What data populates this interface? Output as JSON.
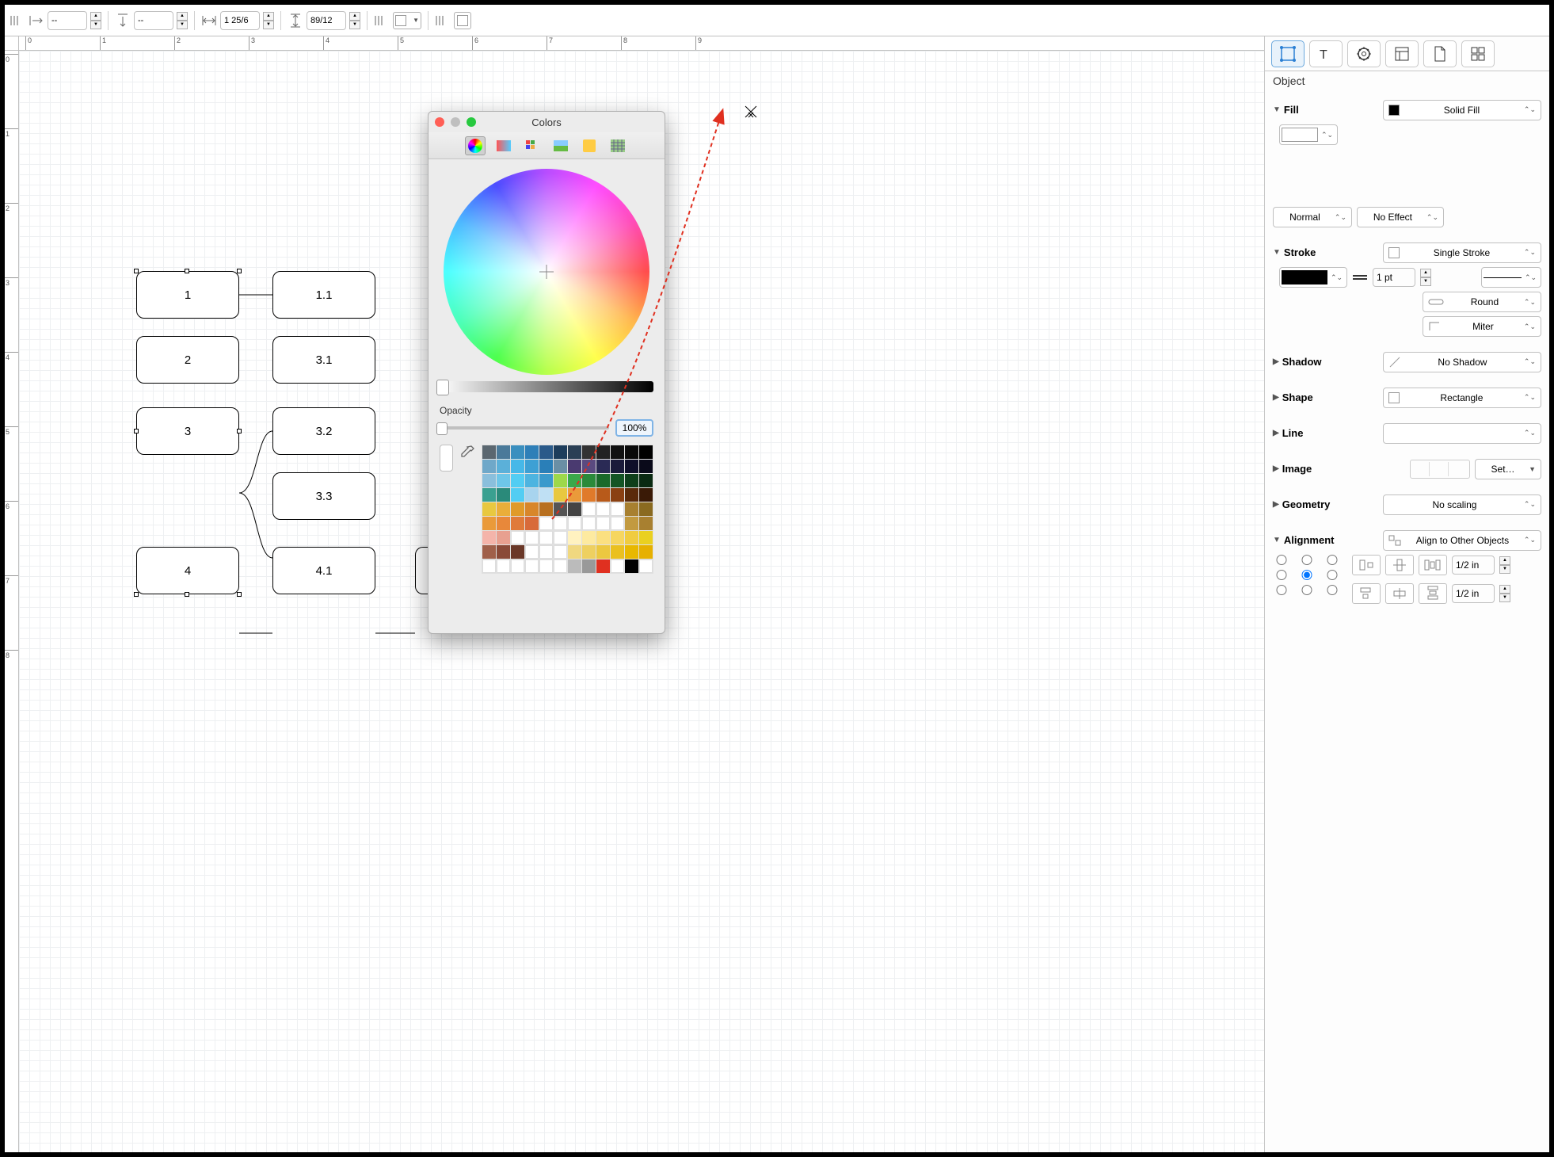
{
  "topbar": {
    "x_val": "--",
    "y_val": "--",
    "w_val": "1 25/6",
    "h_val": "89/12"
  },
  "ruler": {
    "h": [
      "0",
      "1",
      "2",
      "3",
      "4",
      "5",
      "6",
      "7",
      "8",
      "9"
    ],
    "v": [
      "0",
      "1",
      "2",
      "3",
      "4",
      "5",
      "6",
      "7",
      "8"
    ]
  },
  "nodes": {
    "n1": "1",
    "n11": "1.1",
    "n2": "2",
    "n31": "3.1",
    "n3": "3",
    "n32": "3.2",
    "n33": "3.3",
    "n4": "4",
    "n41": "4.1"
  },
  "picker": {
    "title": "Colors",
    "opacity_label": "Opacity",
    "opacity_value": "100%"
  },
  "panel": {
    "title": "Object",
    "fill": {
      "label": "Fill",
      "type": "Solid Fill"
    },
    "blend": {
      "mode": "Normal",
      "effect": "No Effect"
    },
    "stroke": {
      "label": "Stroke",
      "type": "Single Stroke",
      "width": "1 pt",
      "cap": "Round",
      "join": "Miter"
    },
    "shadow": {
      "label": "Shadow",
      "type": "No Shadow"
    },
    "shape": {
      "label": "Shape",
      "type": "Rectangle"
    },
    "line": {
      "label": "Line"
    },
    "image": {
      "label": "Image",
      "set": "Set…"
    },
    "geometry": {
      "label": "Geometry",
      "scaling": "No scaling"
    },
    "alignment": {
      "label": "Alignment",
      "mode": "Align to Other Objects",
      "h_spacing": "1/2 in",
      "v_spacing": "1/2 in"
    }
  }
}
